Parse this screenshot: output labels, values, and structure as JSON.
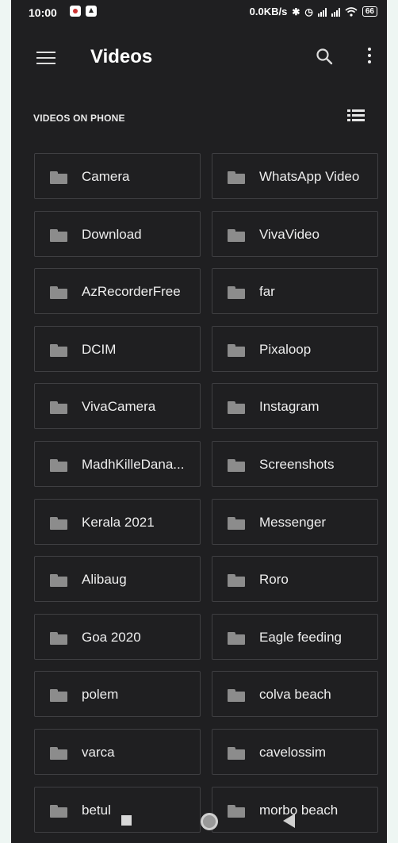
{
  "status_bar": {
    "time": "10:00",
    "net_speed": "0.0KB/s",
    "bluetooth": "✱",
    "alarm": "⏰",
    "wifi": "wifi",
    "battery": "66"
  },
  "app_bar": {
    "title": "Videos"
  },
  "section": {
    "title": "VIDEOS ON PHONE"
  },
  "folders": [
    "Camera",
    "WhatsApp Video",
    "Download",
    "VivaVideo",
    "AzRecorderFree",
    "far",
    "DCIM",
    "Pixaloop",
    "VivaCamera",
    "Instagram",
    "MadhKilleDana...",
    "Screenshots",
    "Kerala 2021",
    "Messenger",
    "Alibaug",
    "Roro",
    "Goa 2020",
    "Eagle feeding",
    "polem",
    "colva beach",
    "varca",
    "cavelossim",
    "betul",
    "morbo beach"
  ],
  "colors": {
    "background": "#1f1f21",
    "card_border": "#3f3f42",
    "folder_icon": "#8c8c8c",
    "text": "#eeeeee"
  },
  "icons": [
    "menu-icon",
    "search-icon",
    "more-vert-icon",
    "list-view-icon",
    "folder-icon",
    "nav-recents-icon",
    "nav-home-icon",
    "nav-back-icon"
  ]
}
